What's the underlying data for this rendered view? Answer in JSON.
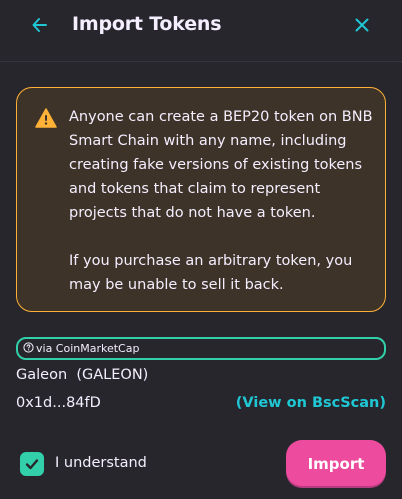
{
  "header": {
    "title": "Import Tokens",
    "back_icon": "arrow-left-icon",
    "close_icon": "close-icon"
  },
  "warning": {
    "icon": "warning-icon",
    "paragraph_1": "Anyone can create a BEP20 token on BNB Smart Chain with any name, including creating fake versions of existing tokens and tokens that claim to represent projects that do not have a token.",
    "paragraph_2": "If you purchase an arbitrary token, you may be unable to sell it back."
  },
  "token": {
    "source_label": "via CoinMarketCap",
    "name_line": "Galeon  (GALEON)",
    "address": "0x1d...84fD",
    "explorer_link": "(View on BscScan)"
  },
  "footer": {
    "checkbox_checked": true,
    "understand_label": "I understand",
    "import_label": "Import"
  },
  "colors": {
    "background": "#27262c",
    "accent_cyan": "#1fc7d4",
    "success_green": "#31d0aa",
    "warning_orange": "#ffb237",
    "primary_pink": "#ed4b9e",
    "text": "#f4eeff"
  }
}
